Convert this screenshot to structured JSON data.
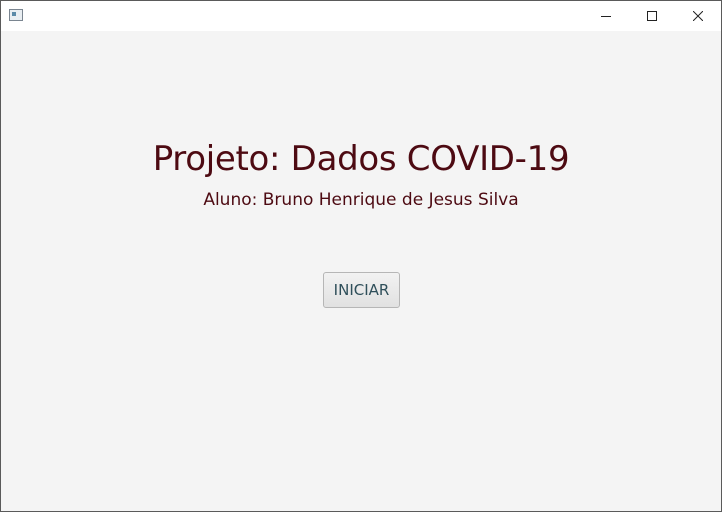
{
  "window": {
    "title": "",
    "icon": "app-window-icon",
    "controls": [
      "minimize-icon",
      "maximize-icon",
      "close-icon"
    ]
  },
  "main": {
    "title": "Projeto: Dados COVID-19",
    "subtitle": "Aluno: Bruno Henrique de Jesus Silva",
    "start_button_label": "INICIAR"
  },
  "colors": {
    "text": "#4d0a12",
    "background": "#f4f4f4",
    "button_text": "#2f4f5a"
  }
}
